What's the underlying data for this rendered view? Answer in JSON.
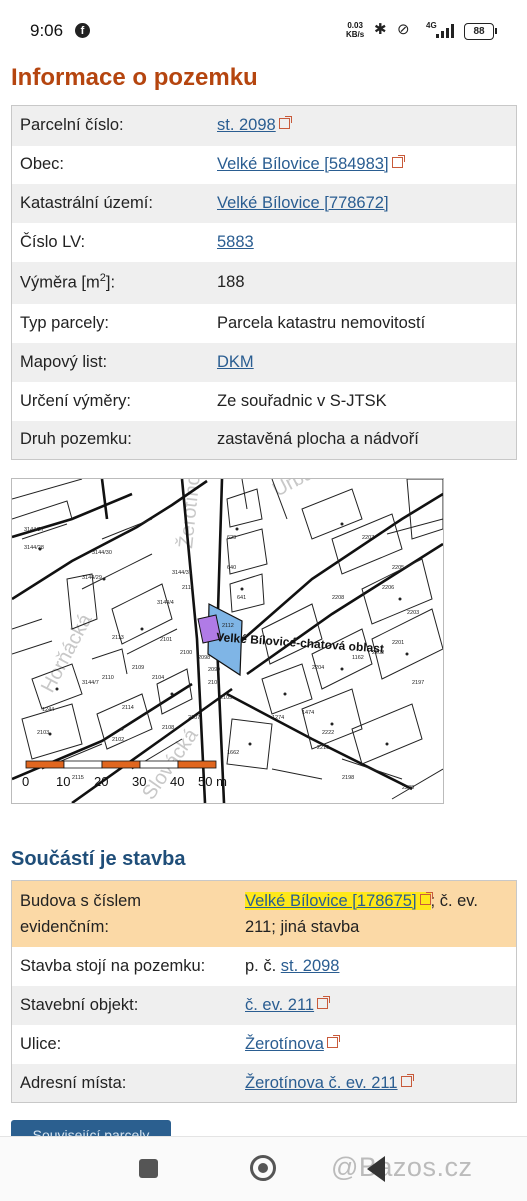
{
  "status_bar": {
    "time": "9:06",
    "app_icon": "facebook-icon",
    "net_speed_value": "0.03",
    "net_speed_unit": "KB/s",
    "network": "4G",
    "battery": "88"
  },
  "page_title": "Informace o pozemku",
  "parcel_info": [
    {
      "label": "Parcelní číslo:",
      "value": "st. 2098",
      "link": true,
      "external": true
    },
    {
      "label": "Obec:",
      "value": "Velké Bílovice [584983]",
      "link": true,
      "external": true
    },
    {
      "label": "Katastrální území:",
      "value": "Velké Bílovice [778672]",
      "link": true,
      "external": false
    },
    {
      "label": "Číslo LV:",
      "value": "5883",
      "link": true,
      "external": false
    },
    {
      "label": "Výměra [m2]:",
      "value": "188",
      "link": false,
      "external": false
    },
    {
      "label": "Typ parcely:",
      "value": "Parcela katastru nemovitostí",
      "link": false,
      "external": false
    },
    {
      "label": "Mapový list:",
      "value": "DKM",
      "link": true,
      "external": false
    },
    {
      "label": "Určení výměry:",
      "value": "Ze souřadnic v S-JTSK",
      "link": false,
      "external": false
    },
    {
      "label": "Druh pozemku:",
      "value": "zastavěná plocha a nádvoří",
      "link": false,
      "external": false
    }
  ],
  "vymera_label": {
    "prefix": "Výměra [m",
    "sup": "2",
    "suffix": "]:"
  },
  "map": {
    "area_label": "Velké Bílovice-chatová oblast",
    "streets": [
      "Žerotínova",
      "Horňácká",
      "Urbanova",
      "Slovácká",
      "Hliníky",
      "Nám. Sv. Urbana"
    ],
    "scale_labels": [
      "0",
      "10",
      "20",
      "30",
      "40",
      "50 m"
    ],
    "parcel_numbers": [
      "2098",
      "2099",
      "2100",
      "2101",
      "2102",
      "2103",
      "2104",
      "2105",
      "2106",
      "2107",
      "2108",
      "2109",
      "2110",
      "2111",
      "2112",
      "2113",
      "2114",
      "2115",
      "1244",
      "1474",
      "1662",
      "2201",
      "2202",
      "2203",
      "2204",
      "2205",
      "2206",
      "2207",
      "2208",
      "2209",
      "2210",
      "3144/7",
      "3144/29",
      "3144/28",
      "3144/27",
      "3144/4",
      "3144/30",
      "3144/31",
      "629",
      "640",
      "641",
      "1162",
      "2197",
      "2222",
      "2198",
      "1274"
    ]
  },
  "section_title": "Součástí je stavba",
  "building_info": [
    {
      "label": "Budova s číslem evidenčním:",
      "value_link": "Velké Bílovice [178675]",
      "value_rest": "; č. ev. 211; jiná stavba",
      "prefix": ""
    },
    {
      "label": "Stavba stojí na pozemku:",
      "prefix": "p. č. ",
      "value_link": "st. 2098",
      "value_rest": ""
    },
    {
      "label": "Stavební objekt:",
      "prefix": "",
      "value_link": "č. ev. 211",
      "value_rest": ""
    },
    {
      "label": "Ulice:",
      "prefix": "",
      "value_link": "Žerotínova",
      "value_rest": ""
    },
    {
      "label": "Adresní místa:",
      "prefix": "",
      "value_link": "Žerotínova č. ev. 211",
      "value_rest": ""
    }
  ],
  "bottom_button": "Související parcely",
  "watermark": "@Bazos.cz",
  "colors": {
    "title": "#b5450f",
    "section": "#1f4e79",
    "link": "#2a5d91",
    "highlight_row": "#fbd9a6",
    "parcel_fill": "#7fb5e6"
  }
}
